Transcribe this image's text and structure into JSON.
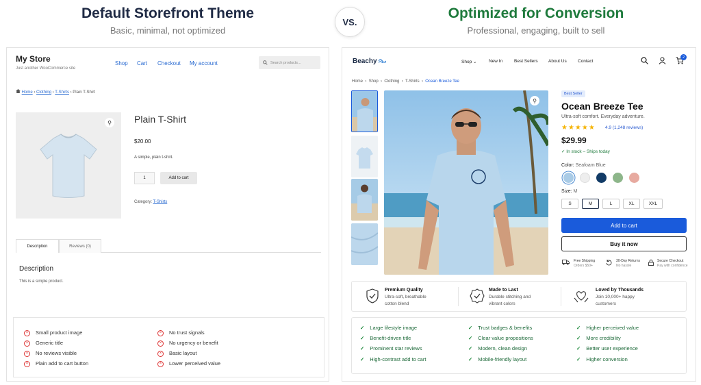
{
  "header": {
    "left_title": "Default Storefront Theme",
    "left_subtitle": "Basic, minimal, not optimized",
    "vs": "VS.",
    "right_title": "Optimized for Conversion",
    "right_subtitle": "Professional, engaging, built to sell"
  },
  "default_store": {
    "brand": "My Store",
    "tagline": "Just another WooCommerce site",
    "nav": [
      "Shop",
      "Cart",
      "Checkout",
      "My account"
    ],
    "search_placeholder": "Search products...",
    "breadcrumb": {
      "home": "Home",
      "clothing": "Clothing",
      "tshirts": "T-Shirts",
      "current": "Plain T-Shirt",
      "sep": "›"
    },
    "product_title": "Plain T-Shirt",
    "price": "$20.00",
    "description_short": "A simple, plain t-shirt.",
    "qty": "1",
    "add_to_cart": "Add to cart",
    "category_label": "Category:",
    "category_link": "T-Shirts",
    "tabs": [
      "Description",
      "Reviews (0)"
    ],
    "desc_heading": "Description",
    "desc_text": "This is a simple product.",
    "negatives": [
      "Small product image",
      "Generic title",
      "No reviews visible",
      "Plain add to cart button",
      "No trust signals",
      "No urgency or benefit",
      "Basic layout",
      "Lower perceived value"
    ],
    "accent": "#2a6bd1"
  },
  "optimized_store": {
    "brand": "Beachy",
    "nav": [
      "Shop ⌄",
      "New In",
      "Best Sellers",
      "About Us",
      "Contact"
    ],
    "cart_count": "2",
    "breadcrumb": [
      "Home",
      "Shop",
      "Clothing",
      "T-Shirts",
      "Ocean Breeze Tee"
    ],
    "badge": "Best Seller",
    "product_title": "Ocean Breeze Tee",
    "subtitle": "Ultra-soft comfort. Everyday adventure.",
    "rating": 4.9,
    "stars": "★★★★★",
    "rating_text": "4.9 (1,248 reviews)",
    "price": "$29.99",
    "stock": "In stock – Ships today",
    "color_label": "Color:",
    "color_value": "Seafoam Blue",
    "swatches": [
      "#a9cbe6",
      "#eeeeee",
      "#123b66",
      "#8db68a",
      "#e7aaa0"
    ],
    "size_label": "Size:",
    "size_value": "M",
    "sizes": [
      "S",
      "M",
      "L",
      "XL",
      "XXL"
    ],
    "add_to_cart": "Add to cart",
    "buy_now": "Buy it now",
    "shipping": [
      {
        "title": "Free Shipping",
        "sub": "Orders $50+"
      },
      {
        "title": "30-Day Returns",
        "sub": "No hassle"
      },
      {
        "title": "Secure Checkout",
        "sub": "Pay with confidence"
      }
    ],
    "features": [
      {
        "title": "Premium Quality",
        "l1": "Ultra-soft, breathable",
        "l2": "cotton blend"
      },
      {
        "title": "Made to Last",
        "l1": "Durable stitching and",
        "l2": "vibrant colors"
      },
      {
        "title": "Loved by Thousands",
        "l1": "Join 10,000+ happy",
        "l2": "customers"
      }
    ],
    "benefits": [
      "Large lifestyle image",
      "Benefit-driven title",
      "Prominent star reviews",
      "High-contrast add to cart",
      "Trust badges & benefits",
      "Clear value propositions",
      "Modern, clean design",
      "Mobile-friendly layout",
      "Higher perceived value",
      "More credibility",
      "Better user experience",
      "Higher conversion"
    ],
    "accent": "#1a5bdb",
    "green": "#1e7a3c"
  }
}
